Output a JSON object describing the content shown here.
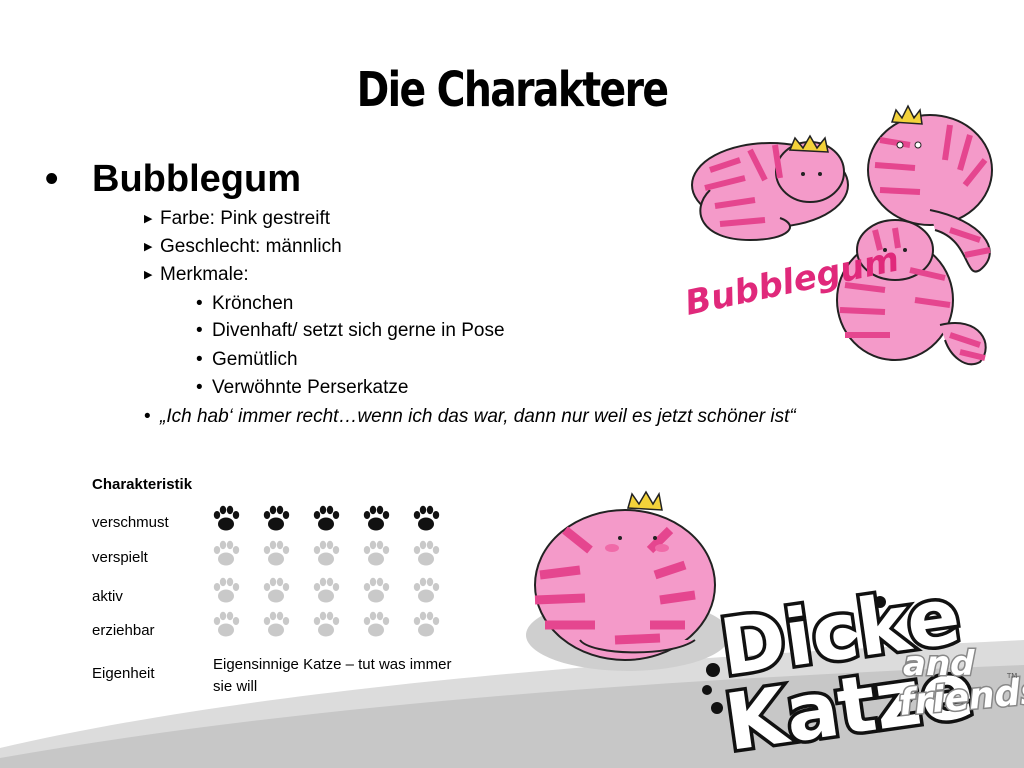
{
  "slide": {
    "title": "Die Charaktere",
    "character_name": "Bubblegum",
    "bullet_glyph": "•",
    "details": [
      {
        "label": "Farbe: Pink gestreift"
      },
      {
        "label": "Geschlecht: männlich"
      },
      {
        "label": "Merkmale:"
      }
    ],
    "merkmale": [
      "Krönchen",
      "Divenhaft/ setzt sich gerne in Pose",
      "Gemütlich",
      "Verwöhnte Perserkatze"
    ],
    "quote": "„Ich hab‘ immer recht…wenn ich das war, dann nur weil es jetzt schöner ist“"
  },
  "characteristics": {
    "heading": "Charakteristik",
    "max": 5,
    "rows": [
      {
        "label": "verschmust",
        "value": 5
      },
      {
        "label": "verspielt",
        "value": 0
      },
      {
        "label": "aktiv",
        "value": 0
      },
      {
        "label": "erziehbar",
        "value": 0
      }
    ],
    "eigenheit_label": "Eigenheit",
    "eigenheit_text": "Eigensinnige Katze – tut was immer sie will"
  },
  "illustration": {
    "signature": "Bubblegum"
  },
  "logo": {
    "line1": "Dicke",
    "line2": "Katze",
    "and": "and",
    "friends": "friends",
    "tm": "TM"
  },
  "colors": {
    "cat_pink": "#f49ac9",
    "cat_stripe": "#e5468f",
    "crown": "#f3d23a",
    "paw_active": "#111111",
    "paw_inactive": "#c9c9c9",
    "swoosh": "#d9d9d9"
  }
}
